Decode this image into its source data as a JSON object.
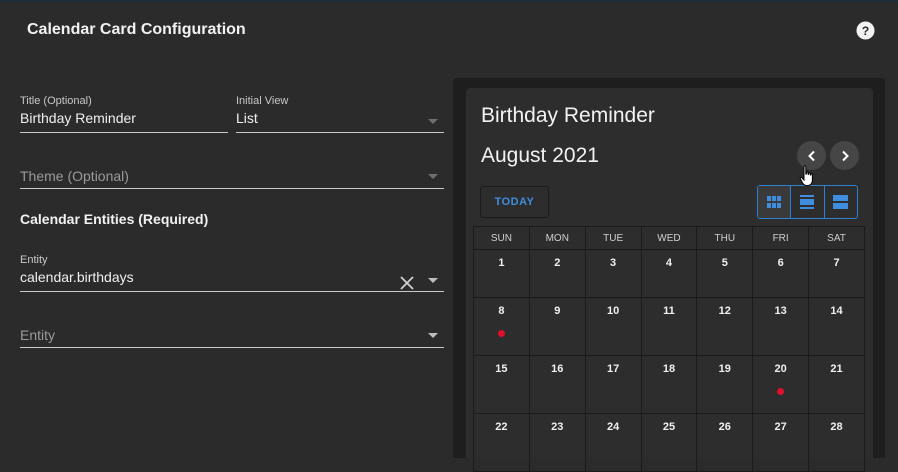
{
  "dialog": {
    "title": "Calendar Card Configuration"
  },
  "form": {
    "title_field": {
      "label": "Title (Optional)",
      "value": "Birthday Reminder"
    },
    "initial_view": {
      "label": "Initial View",
      "value": "List"
    },
    "theme": {
      "placeholder": "Theme (Optional)"
    },
    "entities_heading": "Calendar Entities (Required)",
    "entity_1": {
      "label": "Entity",
      "value": "calendar.birthdays"
    },
    "entity_2": {
      "placeholder": "Entity"
    }
  },
  "preview": {
    "card_title": "Birthday Reminder",
    "month": "August 2021",
    "today_label": "TODAY",
    "accent": "#3f8dde",
    "event_dot_color": "#e0102a",
    "weekdays": [
      "SUN",
      "MON",
      "TUE",
      "WED",
      "THU",
      "FRI",
      "SAT"
    ],
    "weeks": [
      [
        "1",
        "2",
        "3",
        "4",
        "5",
        "6",
        "7"
      ],
      [
        "8",
        "9",
        "10",
        "11",
        "12",
        "13",
        "14"
      ],
      [
        "15",
        "16",
        "17",
        "18",
        "19",
        "20",
        "21"
      ],
      [
        "22",
        "23",
        "24",
        "25",
        "26",
        "27",
        "28"
      ]
    ],
    "event_days": [
      "8",
      "20"
    ]
  }
}
